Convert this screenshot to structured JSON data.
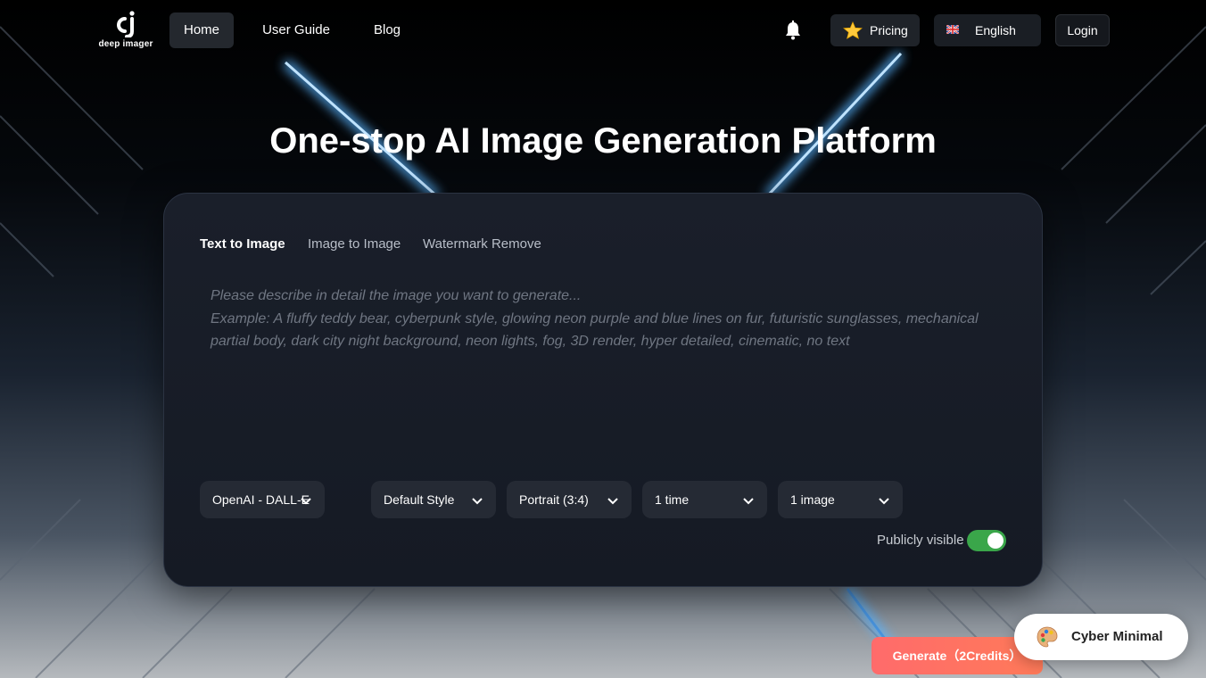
{
  "app": {
    "logo_text": "deep imager"
  },
  "nav": {
    "items": [
      {
        "label": "Home",
        "active": true
      },
      {
        "label": "User Guide",
        "active": false
      },
      {
        "label": "Blog",
        "active": false
      }
    ]
  },
  "header_actions": {
    "notification_icon": "bell-icon",
    "pricing_label": "Pricing",
    "pricing_icon": "star-icon",
    "language_label": "English",
    "language_icon": "uk-flag-icon",
    "login_label": "Login"
  },
  "hero": {
    "title": "One-stop AI Image Generation Platform"
  },
  "generator": {
    "tabs": [
      {
        "label": "Text to Image",
        "active": true
      },
      {
        "label": "Image to Image",
        "active": false
      },
      {
        "label": "Watermark Remove",
        "active": false
      }
    ],
    "prompt": {
      "value": "",
      "placeholder": "Please describe in detail the image you want to generate...\nExample: A fluffy teddy bear, cyberpunk style, glowing neon purple and blue lines on fur, futuristic sunglasses, mechanical partial body, dark city night background, neon lights, fog, 3D render, hyper detailed, cinematic, no text"
    },
    "options": {
      "model": "OpenAI - DALL-E",
      "style": "Default Style",
      "ratio": "Portrait (3:4)",
      "times": "1 time",
      "count": "1 image"
    },
    "public_visibility": {
      "label": "Publicly visible",
      "enabled": true
    },
    "generate_label": "Generate（2Credits）"
  },
  "style_badge": {
    "label": "Cyber Minimal",
    "icon": "palette-icon"
  },
  "colors": {
    "accent_toggle": "#3aa64a",
    "generate_gradient_start": "#ff6b6b",
    "generate_gradient_end": "#ff7a59",
    "panel_bg": "#1a1f2a",
    "neon_blue": "#3fa9ff"
  }
}
